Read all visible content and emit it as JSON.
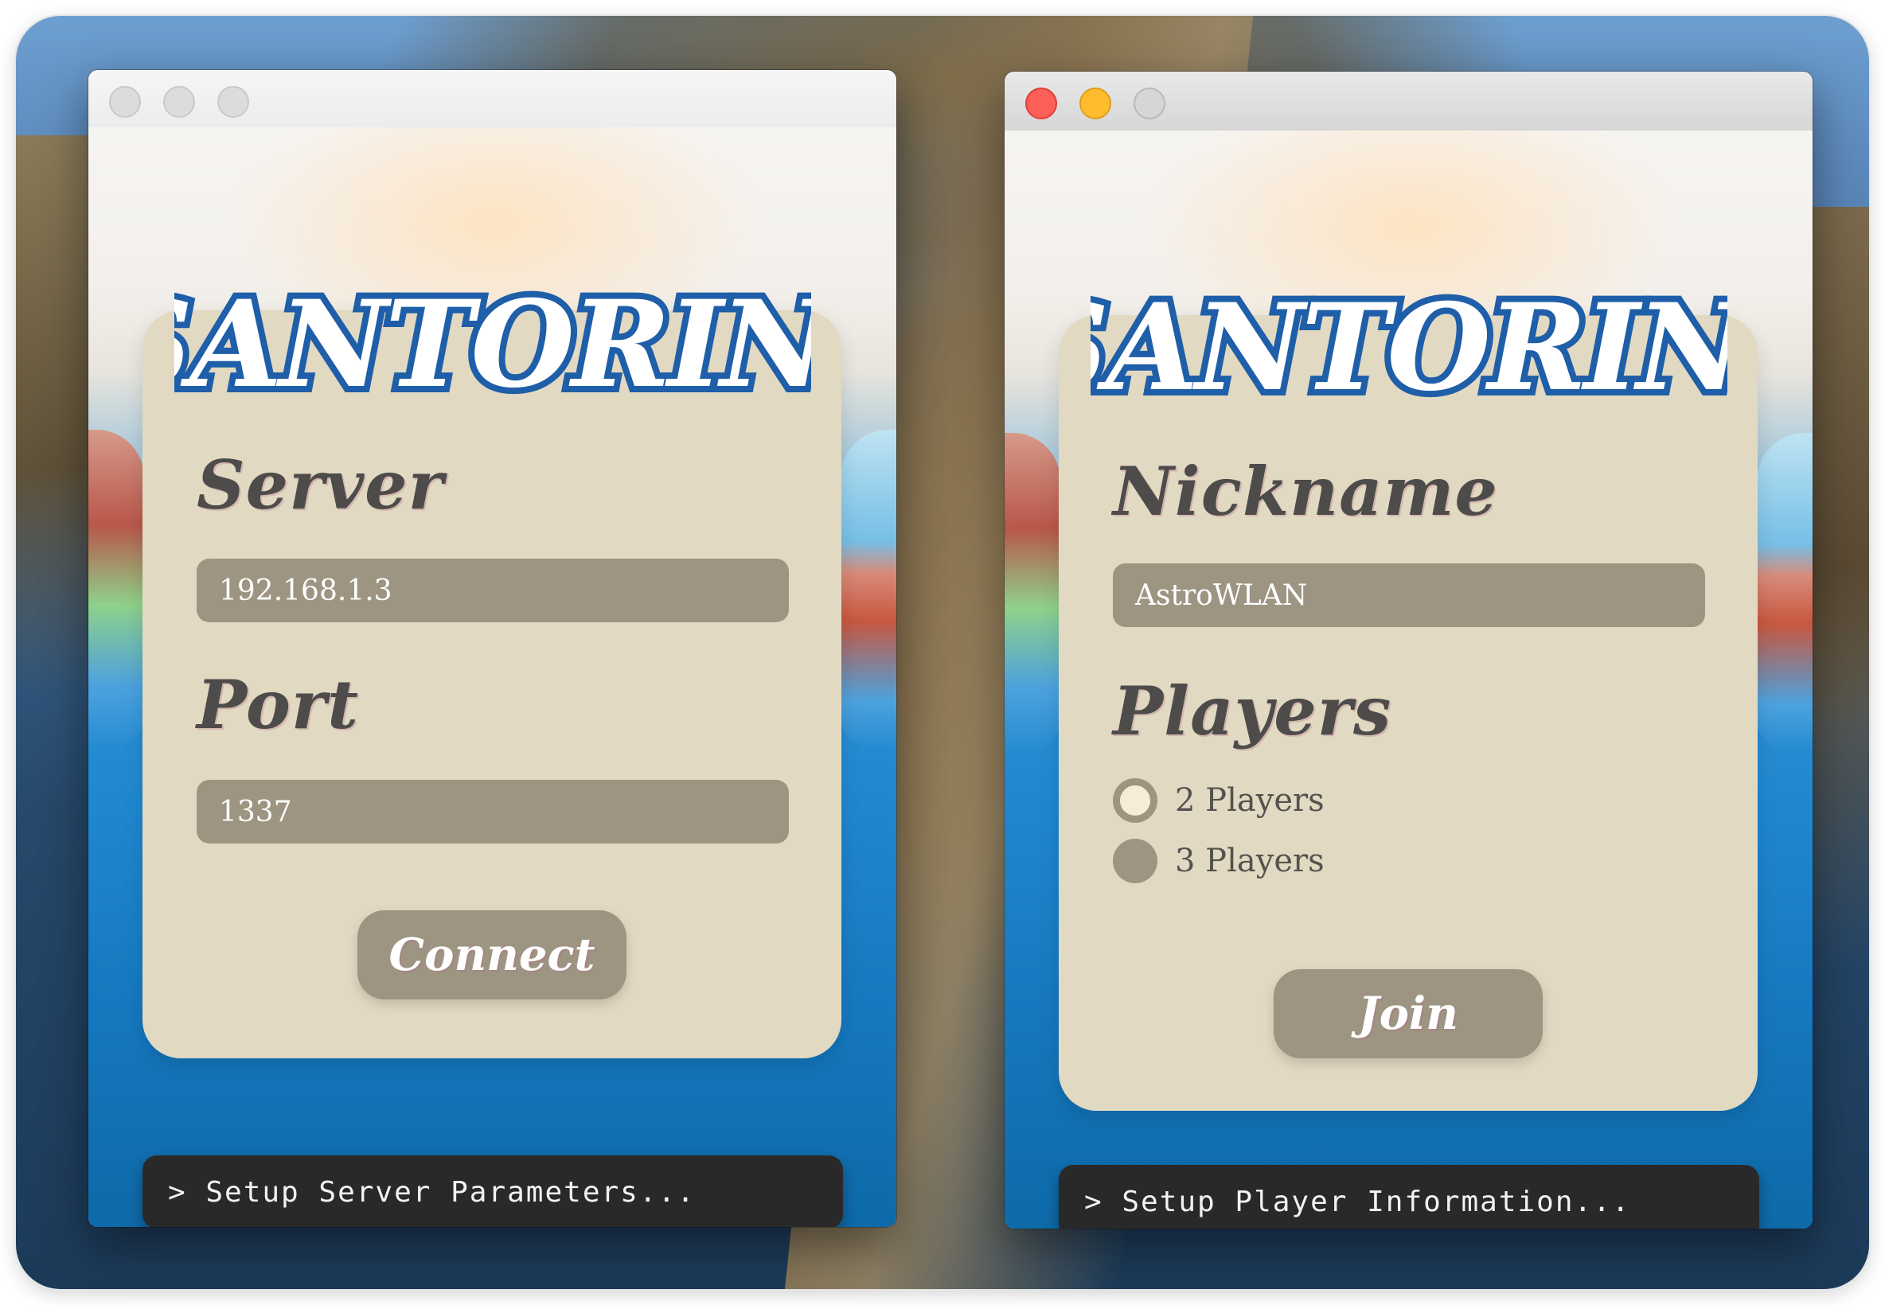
{
  "server_window": {
    "logo_text": "SANTORINI",
    "server_heading": "Server",
    "server_value": "192.168.1.3",
    "port_heading": "Port",
    "port_value": "1337",
    "connect_label": "Connect",
    "console_text": "> Setup Server Parameters..."
  },
  "player_window": {
    "logo_text": "SANTORINI",
    "nickname_heading": "Nickname",
    "nickname_value": "AstroWLAN",
    "players_heading": "Players",
    "options": [
      {
        "label": "2 Players",
        "selected": true
      },
      {
        "label": "3 Players",
        "selected": false
      }
    ],
    "join_label": "Join",
    "console_text": "> Setup Player Information..."
  },
  "colors": {
    "card": "#e1d9c2",
    "field": "#9d9482",
    "heading": "#4e4c4a",
    "console": "#2a2929",
    "logo_fill": "#ffffff",
    "logo_outline": "#1f5ea8"
  },
  "icons": {
    "close": "close-icon",
    "minimize": "minimize-icon",
    "zoom": "zoom-icon"
  }
}
